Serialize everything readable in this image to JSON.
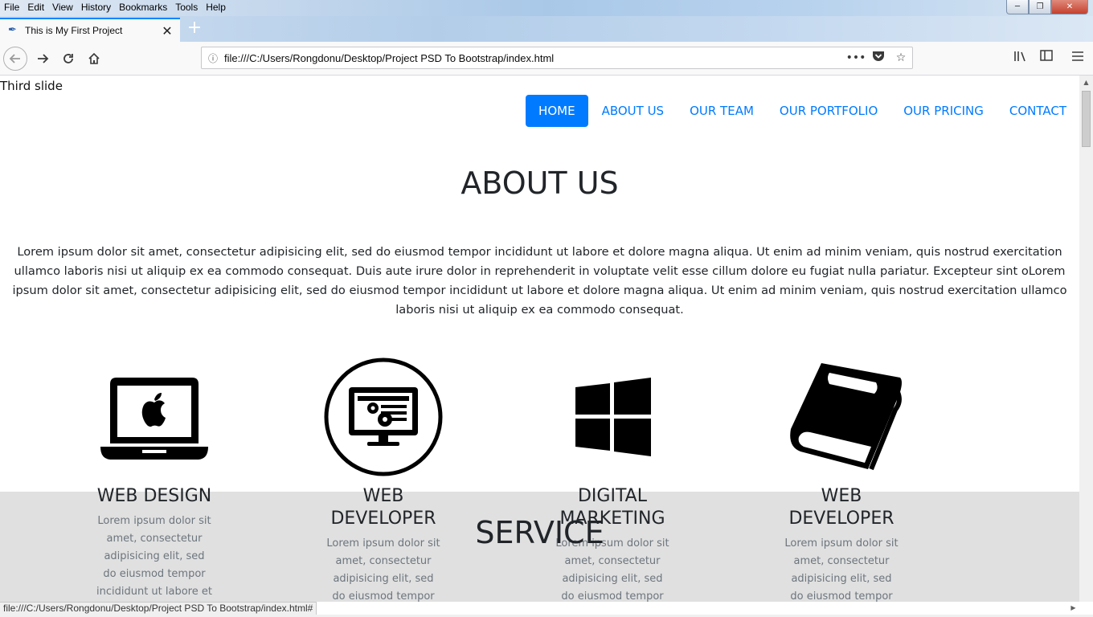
{
  "browser": {
    "menu": [
      "File",
      "Edit",
      "View",
      "History",
      "Bookmarks",
      "Tools",
      "Help"
    ],
    "tab_title": "This is My First Project",
    "url": "file:///C:/Users/Rongdonu/Desktop/Project PSD To Bootstrap/index.html",
    "status_url": "file:///C:/Users/Rongdonu/Desktop/Project PSD To Bootstrap/index.html#",
    "icons": {
      "back": "back-arrow-icon",
      "forward": "forward-arrow-icon",
      "reload": "reload-icon",
      "home": "home-icon",
      "info": "info-icon",
      "more": "more-icon",
      "pocket": "pocket-icon",
      "bookmark": "star-icon",
      "library": "library-icon",
      "sidebar": "sidebar-icon",
      "menu": "hamburger-menu-icon"
    }
  },
  "page": {
    "slide_text": "Third slide",
    "nav": [
      {
        "label": "HOME",
        "active": true
      },
      {
        "label": "ABOUT US",
        "active": false
      },
      {
        "label": "OUR TEAM",
        "active": false
      },
      {
        "label": "OUR PORTFOLIO",
        "active": false
      },
      {
        "label": "OUR PRICING",
        "active": false
      },
      {
        "label": "CONTACT",
        "active": false
      }
    ],
    "about": {
      "title": "ABOUT US",
      "text": "Lorem ipsum dolor sit amet, consectetur adipisicing elit, sed do eiusmod tempor incididunt ut labore et dolore magna aliqua. Ut enim ad minim veniam, quis nostrud exercitation ullamco laboris nisi ut aliquip ex ea commodo consequat. Duis aute irure dolor in reprehenderit in voluptate velit esse cillum dolore eu fugiat nulla pariatur. Excepteur sint oLorem ipsum dolor sit amet, consectetur adipisicing elit, sed do eiusmod tempor incididunt ut labore et dolore magna aliqua. Ut enim ad minim veniam, quis nostrud exercitation ullamco laboris nisi ut aliquip ex ea commodo consequat."
    },
    "features": [
      {
        "icon": "laptop-apple-icon",
        "title": "WEB DESIGN",
        "text": "Lorem ipsum dolor sit amet, consectetur adipisicing elit, sed do eiusmod tempor incididunt ut labore et"
      },
      {
        "icon": "monitor-gears-icon",
        "title": "WEB DEVELOPER",
        "text": "Lorem ipsum dolor sit amet, consectetur adipisicing elit, sed do eiusmod tempor"
      },
      {
        "icon": "windows-logo-icon",
        "title": "DIGITAL MARKETING",
        "text": "Lorem ipsum dolor sit amet, consectetur adipisicing elit, sed do eiusmod tempor"
      },
      {
        "icon": "book-icon",
        "title": "WEB DEVELOPER",
        "text": "Lorem ipsum dolor sit amet, consectetur adipisicing elit, sed do eiusmod tempor"
      }
    ],
    "service_title": "SERVICE"
  }
}
